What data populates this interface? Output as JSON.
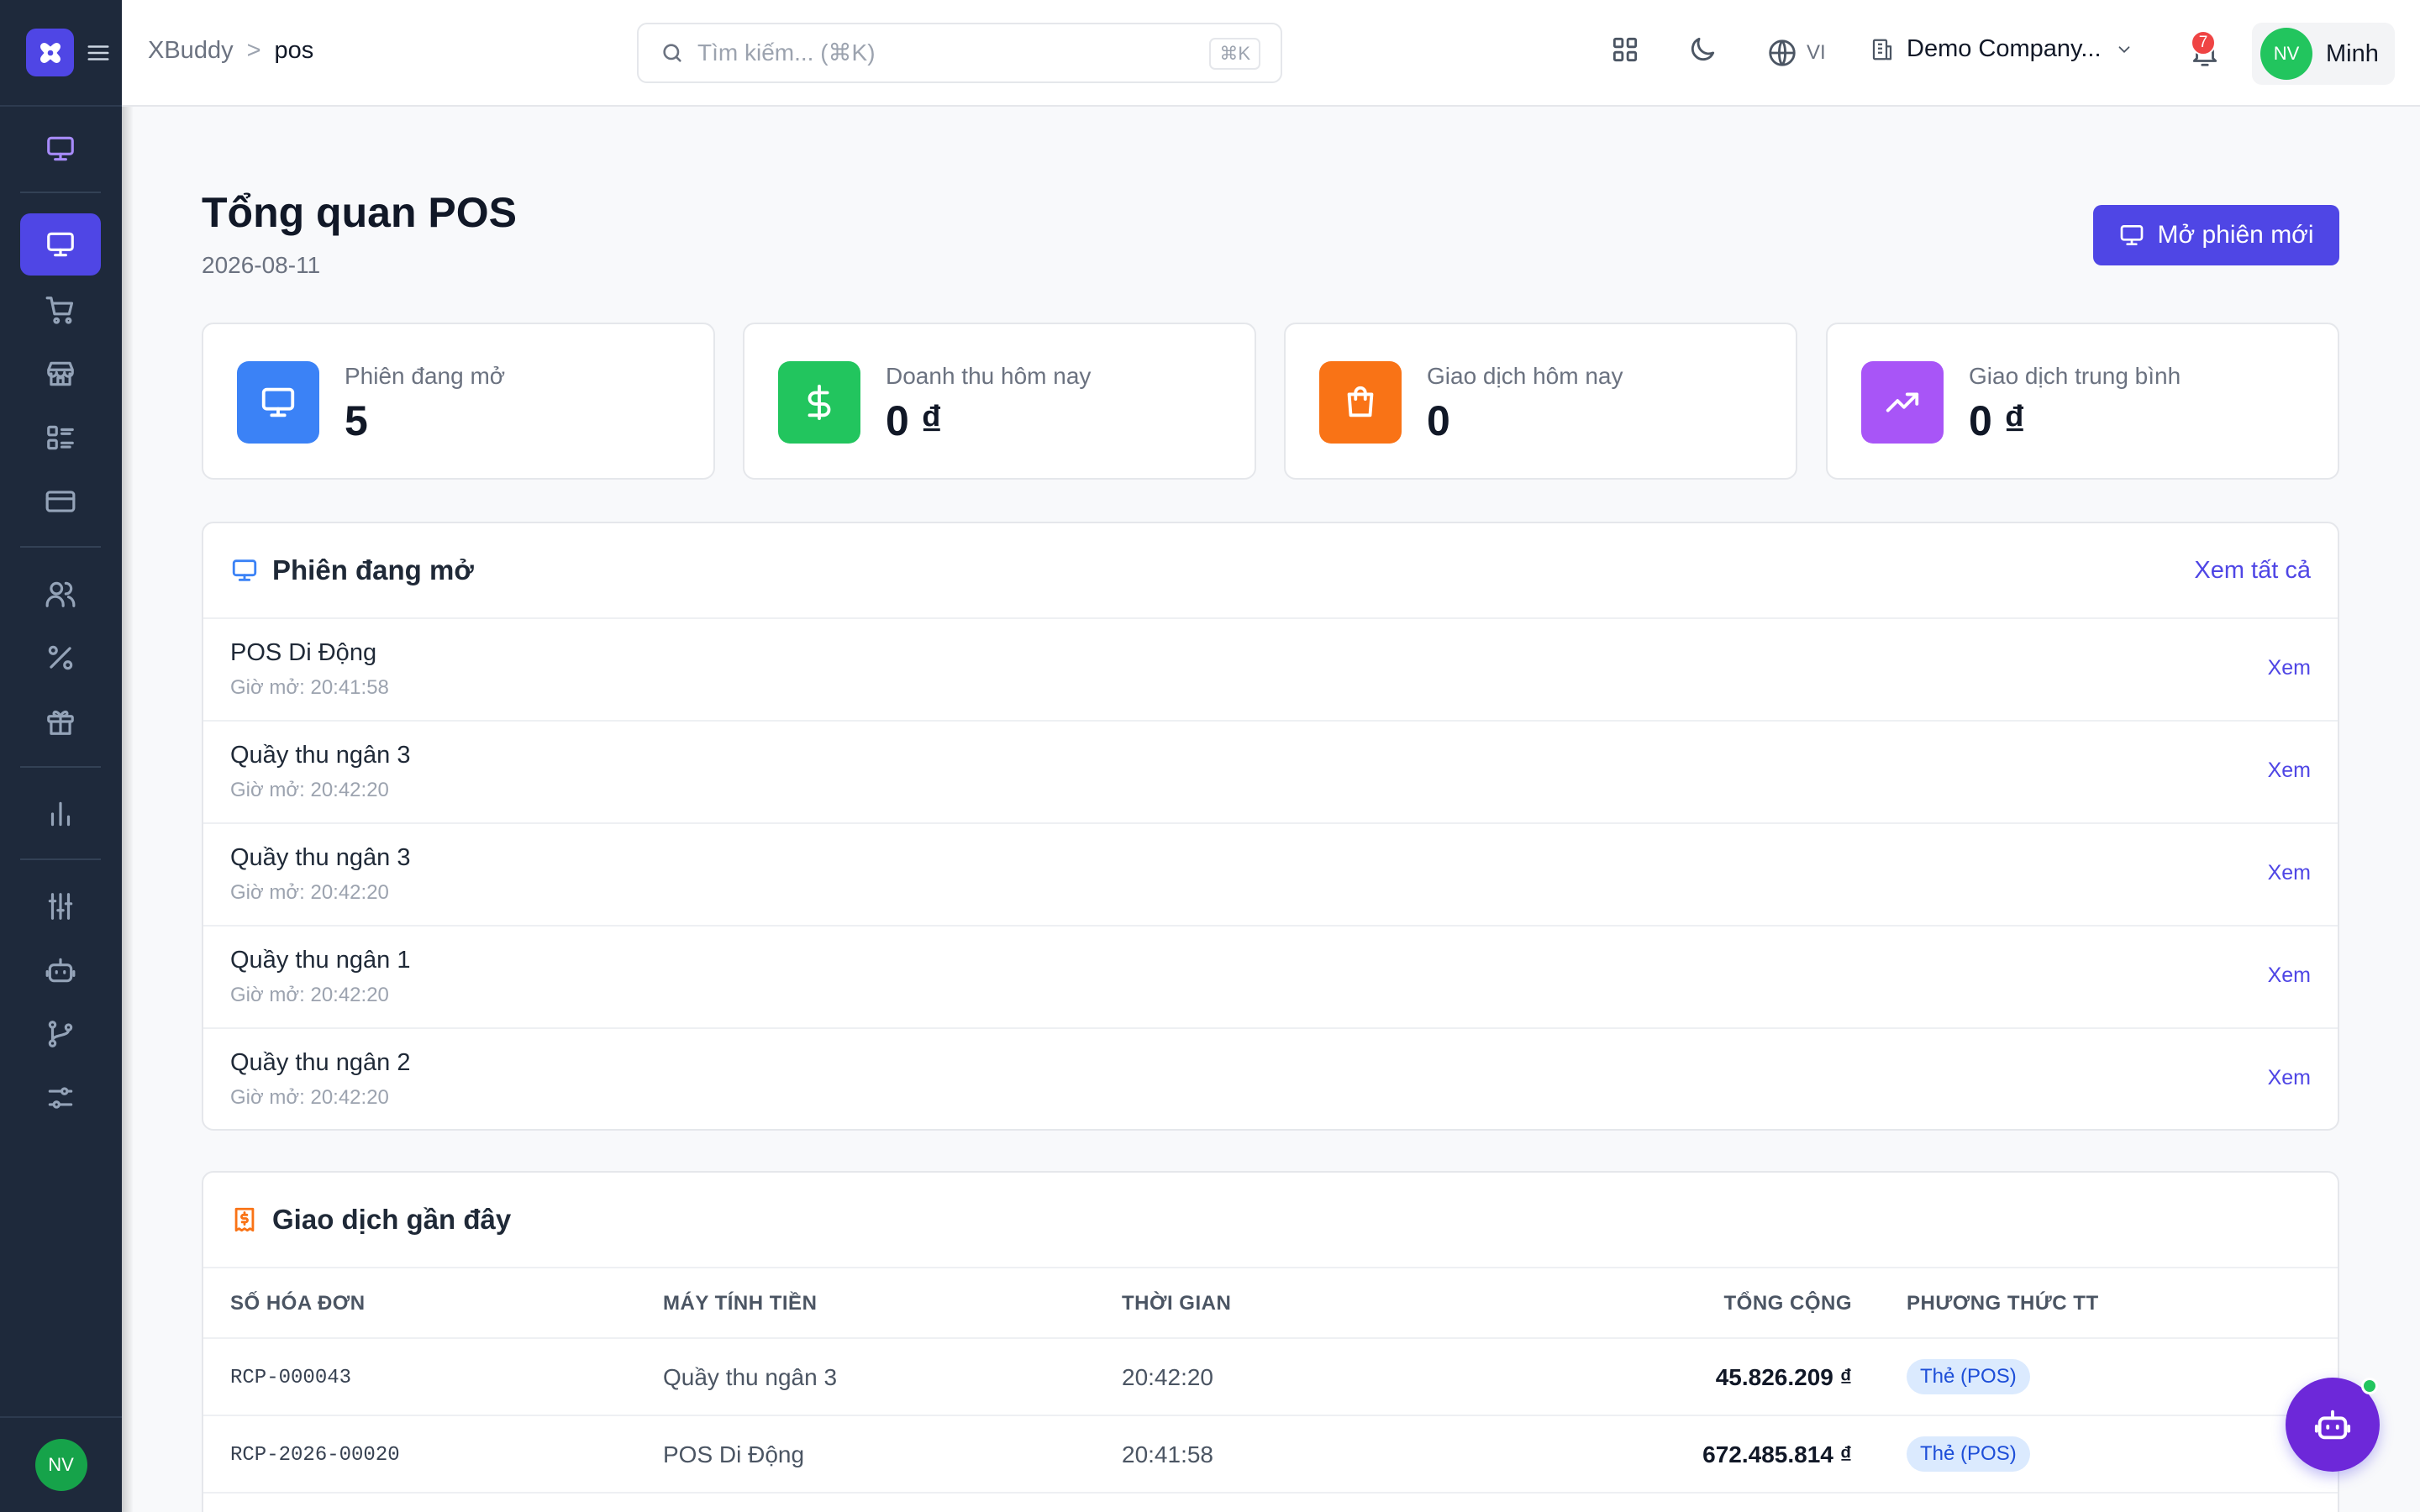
{
  "header": {
    "breadcrumb": [
      "XBuddy",
      "pos"
    ],
    "breadcrumb_sep": ">",
    "search_placeholder": "Tìm kiếm... (⌘K)",
    "search_shortcut": "⌘K",
    "language": "VI",
    "company": "Demo Company...",
    "notification_count": "7",
    "user_initials": "NV",
    "user_name": "Minh"
  },
  "sidebar": {
    "avatar_initials": "NV",
    "icons": [
      "monitor-icon",
      "cart-icon",
      "store-icon",
      "list-icon",
      "credit-card-icon",
      "users-icon",
      "percent-icon",
      "gift-icon",
      "bar-chart-icon",
      "sliders-icon",
      "bot-icon",
      "git-branch-icon",
      "settings-sliders-icon"
    ],
    "active_icon": "monitor-icon"
  },
  "page": {
    "title": "Tổng quan POS",
    "date": "2026-08-11",
    "new_session_button": "Mở phiên mới"
  },
  "stats": [
    {
      "label": "Phiên đang mở",
      "value": "5",
      "icon": "monitor-icon",
      "color": "#3b82f6"
    },
    {
      "label": "Doanh thu hôm nay",
      "value": "0 ₫",
      "icon": "dollar-icon",
      "color": "#22c55e"
    },
    {
      "label": "Giao dịch hôm nay",
      "value": "0",
      "icon": "shopping-bag-icon",
      "color": "#f97316"
    },
    {
      "label": "Giao dịch trung bình",
      "value": "0 ₫",
      "icon": "trending-up-icon",
      "color": "#a855f7"
    }
  ],
  "open_sessions": {
    "title": "Phiên đang mở",
    "view_all": "Xem tất cả",
    "view_label": "Xem",
    "items": [
      {
        "name": "POS Di Động",
        "opened": "Giờ mở: 20:41:58"
      },
      {
        "name": "Quầy thu ngân 3",
        "opened": "Giờ mở: 20:42:20"
      },
      {
        "name": "Quầy thu ngân 3",
        "opened": "Giờ mở: 20:42:20"
      },
      {
        "name": "Quầy thu ngân 1",
        "opened": "Giờ mở: 20:42:20"
      },
      {
        "name": "Quầy thu ngân 2",
        "opened": "Giờ mở: 20:42:20"
      }
    ]
  },
  "recent_transactions": {
    "title": "Giao dịch gần đây",
    "columns": [
      "SỐ HÓA ĐƠN",
      "MÁY TÍNH TIỀN",
      "THỜI GIAN",
      "TỔNG CỘNG",
      "PHƯƠNG THỨC TT"
    ],
    "rows": [
      {
        "invoice": "RCP-000043",
        "register": "Quầy thu ngân 3",
        "time": "20:42:20",
        "total": "45.826.209 ₫",
        "method": "Thẻ (POS)"
      },
      {
        "invoice": "RCP-2026-00020",
        "register": "POS Di Động",
        "time": "20:41:58",
        "total": "672.485.814 ₫",
        "method": "Thẻ (POS)"
      }
    ]
  },
  "colors": {
    "accent": "#4f46e5",
    "sidebar": "#1e293b",
    "success": "#22c55e",
    "danger": "#ef4444"
  }
}
